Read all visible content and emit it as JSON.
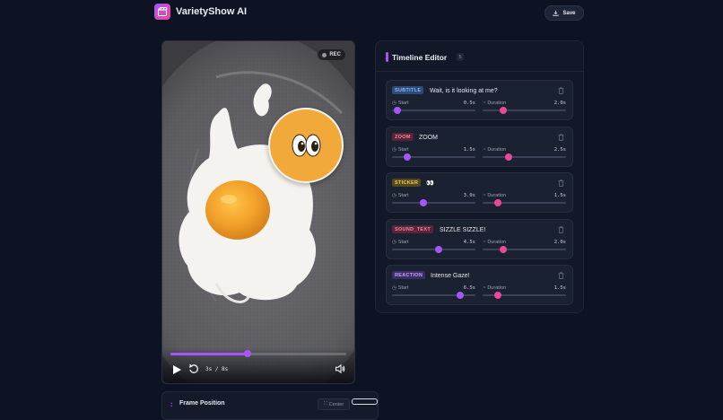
{
  "app": {
    "title": "VarietyShow AI"
  },
  "toolbar": {
    "save_label": "Save"
  },
  "player": {
    "rec_label": "REC",
    "time": "3s / 8s",
    "progress": 0.44,
    "sticker_emoji": "👀"
  },
  "frame_position": {
    "label": "Frame Position",
    "center_label": "Center"
  },
  "timeline": {
    "title": "Timeline Editor",
    "count": "5",
    "start_label": "Start",
    "duration_label": "Duration",
    "max_start": 8,
    "max_duration": 8,
    "items": [
      {
        "type": "SUBTITLE",
        "text": "Wait, is it looking at me?",
        "start": "0.5s",
        "duration": "2.0s",
        "start_val": 0.5,
        "dur_val": 2.0
      },
      {
        "type": "ZOOM",
        "text": "ZOOM",
        "start": "1.5s",
        "duration": "2.5s",
        "start_val": 1.5,
        "dur_val": 2.5
      },
      {
        "type": "STICKER",
        "text": "👀",
        "start": "3.0s",
        "duration": "1.5s",
        "start_val": 3.0,
        "dur_val": 1.5
      },
      {
        "type": "SOUND_TEXT",
        "text": "SIZZLE SIZZLE!",
        "start": "4.5s",
        "duration": "2.0s",
        "start_val": 4.5,
        "dur_val": 2.0
      },
      {
        "type": "REACTION",
        "text": "Intense Gaze!",
        "start": "6.5s",
        "duration": "1.5s",
        "start_val": 6.5,
        "dur_val": 1.5
      }
    ]
  },
  "colors": {
    "accent": "#a855f7",
    "duration_knob": "#ec4899",
    "subtitle_badge": "#2c4a7a",
    "zoom_badge": "#5a2436",
    "sticker_badge": "#55471c",
    "sound_badge": "#5a2436",
    "reaction_badge": "#3b2c66"
  }
}
